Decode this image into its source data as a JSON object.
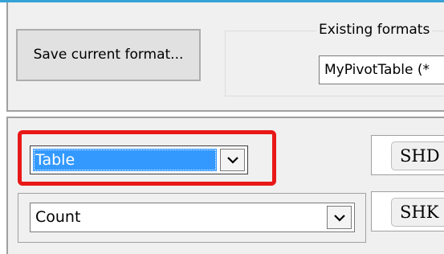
{
  "top": {
    "save_button_label": "Save current format...",
    "formats_group_label": "Existing formats",
    "formats_selected": "MyPivotTable (*"
  },
  "bottom": {
    "type_combo_value": "Table",
    "aggregate_combo_value": "Count",
    "side_buttons": [
      "SHD",
      "SHK"
    ]
  },
  "icons": {
    "dropdown": "chevron-down-icon"
  },
  "colors": {
    "accent": "#35a3d6",
    "selection": "#3399ff",
    "highlight_annotation": "#e81818"
  }
}
